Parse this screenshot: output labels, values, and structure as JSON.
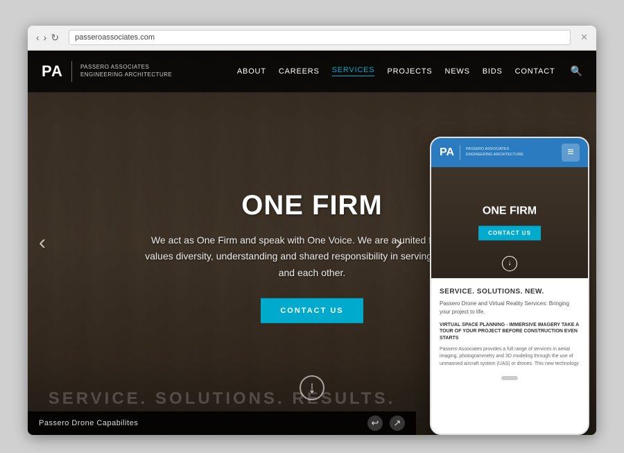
{
  "browser": {
    "back_icon": "‹",
    "forward_icon": "›",
    "refresh_icon": "↻",
    "close_icon": "✕"
  },
  "navbar": {
    "logo_pa": "PA",
    "logo_company": "PASSERO ASSOCIATES",
    "logo_tagline": "engineering  architecture",
    "nav_items": [
      {
        "label": "ABOUT",
        "active": false
      },
      {
        "label": "CAREERS",
        "active": false
      },
      {
        "label": "SERVICES",
        "active": true
      },
      {
        "label": "PROJECTS",
        "active": false
      },
      {
        "label": "NEWS",
        "active": false
      },
      {
        "label": "BIDS",
        "active": false
      },
      {
        "label": "CONTACT",
        "active": false
      }
    ],
    "search_icon": "🔍"
  },
  "hero": {
    "title": "ONE FIRM",
    "subtitle": "We act as One Firm and speak with One Voice.\nWe are a united family that values diversity,\nunderstanding and shared responsibility in\nserving our clients and each other.",
    "cta_label": "CONTACT US",
    "arrow_left": "‹",
    "arrow_right": "›",
    "scroll_icon": "↓"
  },
  "bottom_bar": {
    "text": "Passero Drone Capabilites",
    "icon1": "↩",
    "icon2": "↗"
  },
  "section_teaser": {
    "heading": "SERVICE. SOLUTIONS. RESULTS."
  },
  "mobile": {
    "logo_pa": "PA",
    "logo_company": "PASSERO ASSOCIATES",
    "logo_tagline": "engineering  architecture",
    "menu_icon": "≡",
    "hero_title": "ONE FIRM",
    "hero_cta": "CONTACT US",
    "scroll_icon": "↓",
    "section_title": "SERVICE. SOLUTIONS. NEW.",
    "section_subtitle": "Passero Drone and Virtual Reality Services: Bringing your project to life.",
    "section_bold": "Virtual Space Planning - Immersive Imagery\nTAKE A TOUR OF YOUR PROJECT BEFORE CONSTRUCTION EVEN STARTS",
    "section_body": "Passero Associates provides a full range of services in aerial imaging, photogrammetry and 3D modeling through the use of unmanned aircraft system (UAS) or drones. This new technology"
  },
  "colors": {
    "accent_blue": "#00aacc",
    "nav_blue": "#2a7bbf",
    "dark_overlay": "rgba(0,0,0,0.75)",
    "hero_bg": "#4a3f35"
  }
}
